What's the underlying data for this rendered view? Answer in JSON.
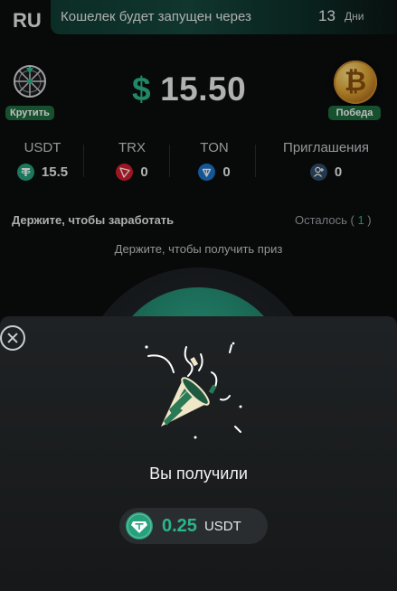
{
  "header": {
    "language": "RU",
    "banner_text": "Кошелек будет запущен через",
    "days_value": "13",
    "days_unit": "Дни"
  },
  "balance": {
    "currency_symbol": "$",
    "amount": "15.50",
    "spin_label": "Крутить",
    "win_label": "Победа"
  },
  "stats": [
    {
      "label": "USDT",
      "value": "15.5",
      "icon": "tether-icon"
    },
    {
      "label": "TRX",
      "value": "0",
      "icon": "tron-icon"
    },
    {
      "label": "TON",
      "value": "0",
      "icon": "ton-icon"
    },
    {
      "label": "Приглашения",
      "value": "0",
      "icon": "add-user-icon"
    }
  ],
  "hold": {
    "title": "Держите, чтобы заработать",
    "remaining_label": "Осталось",
    "remaining_count": "1",
    "hint": "Держите, чтобы получить приз"
  },
  "reward_modal": {
    "title": "Вы получили",
    "amount": "0.25",
    "unit": "USDT"
  },
  "colors": {
    "accent": "#2bb58a",
    "pill": "#1f6b3e",
    "tether": "#26a17b",
    "tron": "#d01f2e",
    "ton": "#1d74c9"
  }
}
